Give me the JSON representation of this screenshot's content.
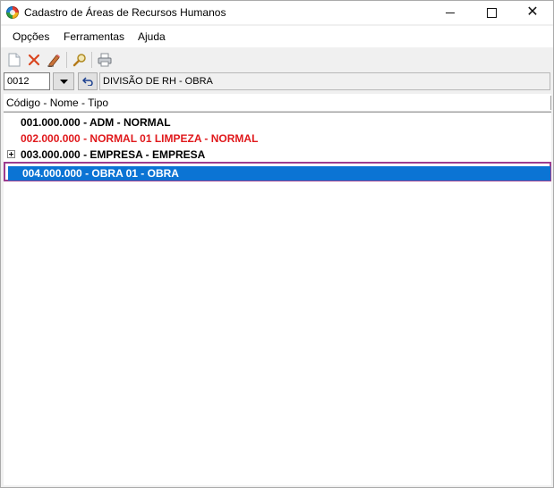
{
  "window": {
    "title": "Cadastro de Áreas de Recursos Humanos"
  },
  "menu": {
    "items": [
      "Opções",
      "Ferramentas",
      "Ajuda"
    ]
  },
  "toolbar": {
    "icons": [
      "new-document-icon",
      "delete-icon",
      "edit-icon",
      "search-icon",
      "print-icon"
    ]
  },
  "selector": {
    "code": "0012",
    "description": "DIVISÃO DE RH - OBRA"
  },
  "tree": {
    "header": "Código - Nome - Tipo",
    "rows": [
      {
        "label": "001.000.000 - ADM - NORMAL",
        "color": "#000000"
      },
      {
        "label": "002.000.000 - NORMAL 01 LIMPEZA - NORMAL",
        "color": "#e0191c"
      },
      {
        "label": "003.000.000 - EMPRESA - EMPRESA",
        "color": "#000000",
        "expandable": true
      },
      {
        "label": "004.000.000 - OBRA 01 - OBRA",
        "color": "#ffffff",
        "selected": true
      }
    ]
  },
  "colors": {
    "selection": "#0b74d4",
    "selection_outline": "#9c3d8f",
    "error_red": "#e0191c"
  }
}
